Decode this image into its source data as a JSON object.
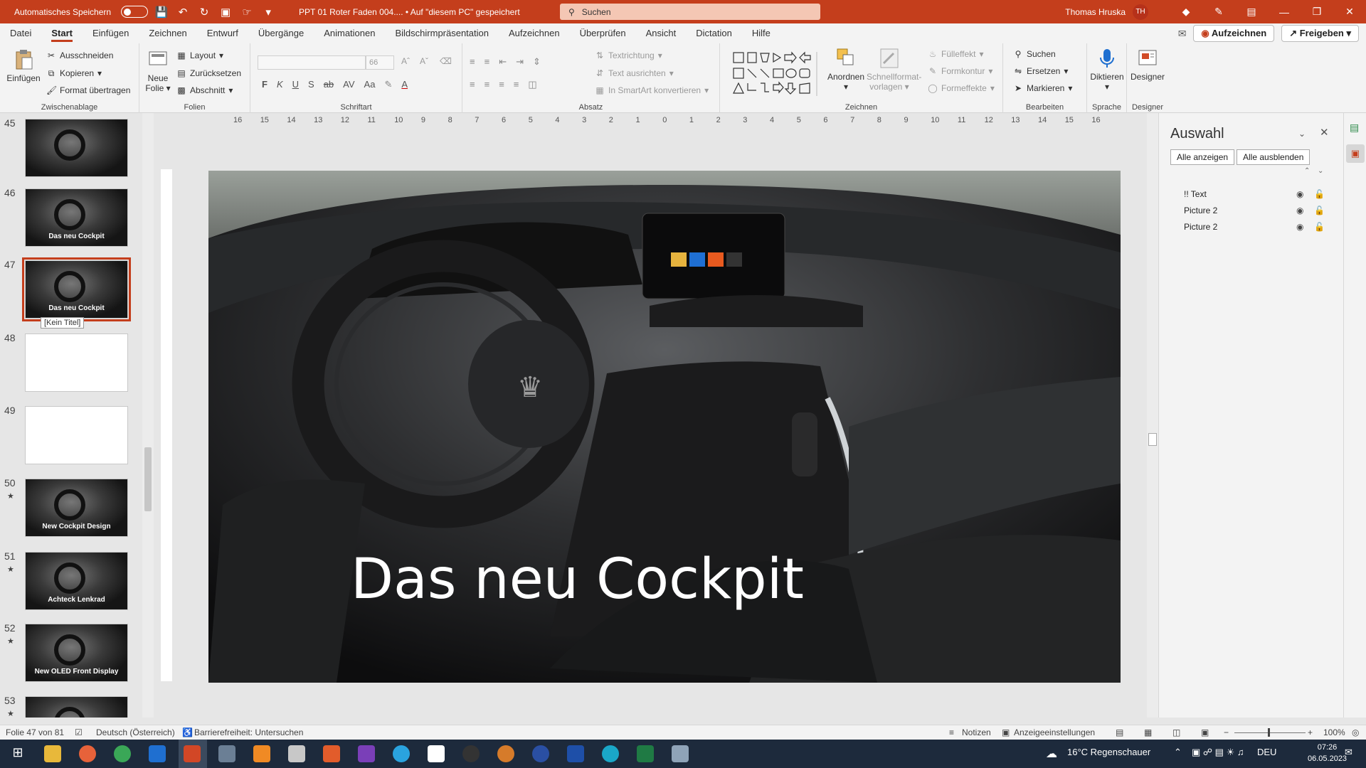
{
  "titlebar": {
    "autosave_label": "Automatisches Speichern",
    "document": "PPT 01 Roter Faden 004....  •  Auf \"diesem PC\" gespeichert",
    "search_placeholder": "Suchen",
    "user_name": "Thomas Hruska",
    "user_initials": "TH"
  },
  "tabs": [
    "Datei",
    "Start",
    "Einfügen",
    "Zeichnen",
    "Entwurf",
    "Übergänge",
    "Animationen",
    "Bildschirmpräsentation",
    "Aufzeichnen",
    "Überprüfen",
    "Ansicht",
    "Dictation",
    "Hilfe"
  ],
  "active_tab": "Start",
  "tabs_right": {
    "record": "Aufzeichnen",
    "share": "Freigeben"
  },
  "ribbon": {
    "clipboard": {
      "label": "Zwischenablage",
      "paste": "Einfügen",
      "cut": "Ausschneiden",
      "copy": "Kopieren",
      "format_painter": "Format übertragen"
    },
    "slides": {
      "label": "Folien",
      "new_slide_1": "Neue",
      "new_slide_2": "Folie",
      "layout": "Layout",
      "reset": "Zurücksetzen",
      "section": "Abschnitt"
    },
    "font": {
      "label": "Schriftart",
      "size": "66",
      "bold": "F",
      "italic": "K",
      "underline": "U",
      "shadow": "S",
      "strike": "ab",
      "spacing": "AV",
      "case": "Aa",
      "color": "A"
    },
    "paragraph": {
      "label": "Absatz",
      "text_direction": "Textrichtung",
      "align_text": "Text ausrichten",
      "smartart": "In SmartArt konvertieren"
    },
    "drawing": {
      "label": "Zeichnen",
      "arrange": "Anordnen",
      "quick_styles_1": "Schnellformat-",
      "quick_styles_2": "vorlagen",
      "fill": "Fülleffekt",
      "outline": "Formkontur",
      "effects": "Formeffekte"
    },
    "editing": {
      "label": "Bearbeiten",
      "find": "Suchen",
      "replace": "Ersetzen",
      "select": "Markieren"
    },
    "voice": {
      "label": "Sprache",
      "dictate": "Diktieren"
    },
    "designer": {
      "label": "Designer",
      "button": "Designer"
    }
  },
  "thumbnails": [
    {
      "num": "45",
      "star": false,
      "type": "cockpit-text",
      "caption": ""
    },
    {
      "num": "46",
      "star": false,
      "type": "cockpit",
      "caption": "Das neu Cockpit"
    },
    {
      "num": "47",
      "star": false,
      "type": "cockpit",
      "caption": "Das neu Cockpit",
      "selected": true
    },
    {
      "num": "48",
      "star": false,
      "type": "white",
      "caption": ""
    },
    {
      "num": "49",
      "star": false,
      "type": "white",
      "caption": ""
    },
    {
      "num": "50",
      "star": true,
      "type": "cockpit",
      "caption": "New Cockpit Design"
    },
    {
      "num": "51",
      "star": true,
      "type": "cockpit",
      "caption": "Achteck Lenkrad"
    },
    {
      "num": "52",
      "star": true,
      "type": "cockpit",
      "caption": "New OLED Front Display"
    },
    {
      "num": "53",
      "star": true,
      "type": "cockpit",
      "caption": ""
    }
  ],
  "tooltip": "[Kein Titel]",
  "ruler_labels": [
    "16",
    "15",
    "14",
    "13",
    "12",
    "11",
    "10",
    "9",
    "8",
    "7",
    "6",
    "5",
    "4",
    "3",
    "2",
    "1",
    "0",
    "1",
    "2",
    "3",
    "4",
    "5",
    "6",
    "7",
    "8",
    "9",
    "10",
    "11",
    "12",
    "13",
    "14",
    "15",
    "16"
  ],
  "slide": {
    "title": "Das neu Cockpit"
  },
  "selection_pane": {
    "title": "Auswahl",
    "show_all": "Alle anzeigen",
    "hide_all": "Alle ausblenden",
    "items": [
      "!! Text",
      "Picture 2",
      "Picture 2"
    ]
  },
  "status": {
    "slide_info": "Folie 47 von 81",
    "language": "Deutsch (Österreich)",
    "accessibility": "Barrierefreiheit: Untersuchen",
    "notes": "Notizen",
    "display_settings": "Anzeigeeinstellungen",
    "zoom": "100%"
  },
  "taskbar": {
    "weather": "16°C  Regenschauer",
    "lang": "DEU",
    "time": "07:26",
    "date": "06.05.2023"
  }
}
